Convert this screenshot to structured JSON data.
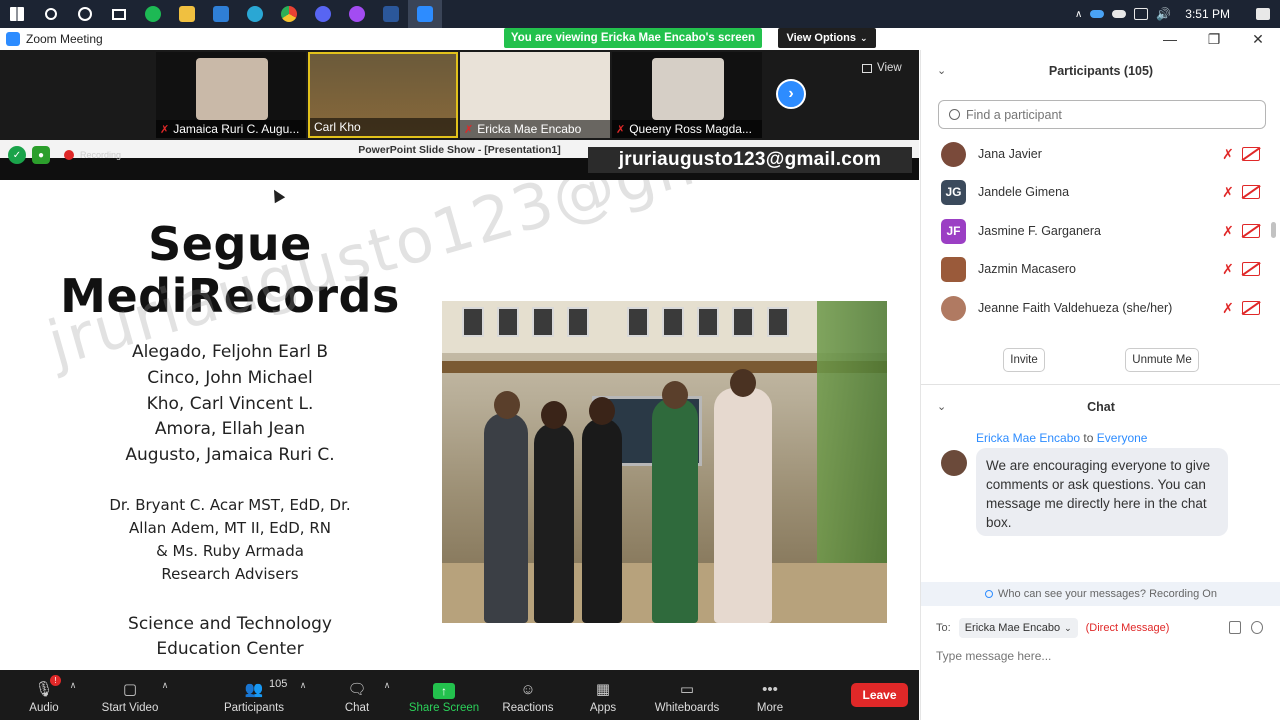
{
  "taskbar": {
    "time": "3:51 PM",
    "apps": [
      {
        "name": "windows-start",
        "color": "#ffffff"
      },
      {
        "name": "search",
        "color": "#ffffff"
      },
      {
        "name": "cortana",
        "color": "#ffffff"
      },
      {
        "name": "task-view",
        "color": "#ffffff"
      },
      {
        "name": "spotify",
        "color": "#1db954"
      },
      {
        "name": "file-explorer",
        "color": "#f0c040"
      },
      {
        "name": "mail",
        "color": "#2f7fd6"
      },
      {
        "name": "edge",
        "color": "#2aa7d4"
      },
      {
        "name": "chrome",
        "color": "#e8b531"
      },
      {
        "name": "discord",
        "color": "#5865f2"
      },
      {
        "name": "messenger",
        "color": "#a34cf2"
      },
      {
        "name": "word",
        "color": "#2b579a"
      },
      {
        "name": "zoom",
        "color": "#2d8cff"
      }
    ]
  },
  "window": {
    "title": "Zoom Meeting",
    "viewing_banner": "You are viewing Ericka Mae Encabo's screen",
    "view_options": "View Options"
  },
  "thumbnails": [
    {
      "name": "Jamaica Ruri C. Augu...",
      "color": "#c9b9a8",
      "muted": true
    },
    {
      "name": "Carl Kho",
      "color": "#8a6a3b",
      "muted": false,
      "active": true
    },
    {
      "name": "Ericka Mae Encabo",
      "color": "#e9e2d8",
      "muted": true
    },
    {
      "name": "Queeny Ross Magda...",
      "color": "#d6cfc6",
      "muted": true
    }
  ],
  "view_label": "View",
  "share": {
    "title": "PowerPoint Slide Show - [Presentation1]",
    "email": "jruriaugusto123@gmail.com",
    "recording_label": "Recording"
  },
  "slide": {
    "title_line1": "Segue",
    "title_line2": "MediRecords",
    "members": [
      "Alegado, Feljohn Earl B",
      "Cinco, John Michael",
      "Kho, Carl Vincent L.",
      "Amora, Ellah Jean",
      "Augusto, Jamaica Ruri C."
    ],
    "advisers": [
      "Dr. Bryant C. Acar MST, EdD, Dr.",
      "Allan Adem, MT II, EdD, RN",
      "& Ms. Ruby Armada",
      "Research Advisers"
    ],
    "school": [
      "Science and Technology",
      "Education Center"
    ],
    "watermark": "jruriaugusto123@gmail.com"
  },
  "controls": {
    "audio": "Audio",
    "start_video": "Start Video",
    "participants": "Participants",
    "participant_count": "105",
    "chat": "Chat",
    "share_screen": "Share Screen",
    "reactions": "Reactions",
    "apps": "Apps",
    "whiteboards": "Whiteboards",
    "more": "More",
    "leave": "Leave",
    "audio_badge": "!"
  },
  "participants_panel": {
    "header": "Participants (105)",
    "search_placeholder": "Find a participant",
    "list": [
      {
        "name": "Jana Javier",
        "initials": "",
        "color": "#7a4a3a"
      },
      {
        "name": "Jandele Gimena",
        "initials": "JG",
        "color": "#3b4a5c"
      },
      {
        "name": "Jasmine F. Garganera",
        "initials": "JF",
        "color": "#9b3fc4"
      },
      {
        "name": "Jazmin Macasero",
        "initials": "",
        "color": "#9a5a3a"
      },
      {
        "name": "Jeanne Faith Valdehueza (she/her)",
        "initials": "",
        "color": "#b07a62"
      }
    ],
    "invite": "Invite",
    "unmute_me": "Unmute Me"
  },
  "chat_panel": {
    "header": "Chat",
    "sender": "Ericka Mae Encabo",
    "to_word": "to",
    "recipient": "Everyone",
    "message": "We are encouraging everyone to give comments or ask questions. You can message me directly here in the chat box.",
    "who_can_see": "Who can see your messages? Recording On",
    "to_label": "To:",
    "to_value": "Ericka Mae Encabo",
    "direct_message": "(Direct Message)",
    "input_placeholder": "Type message here..."
  }
}
